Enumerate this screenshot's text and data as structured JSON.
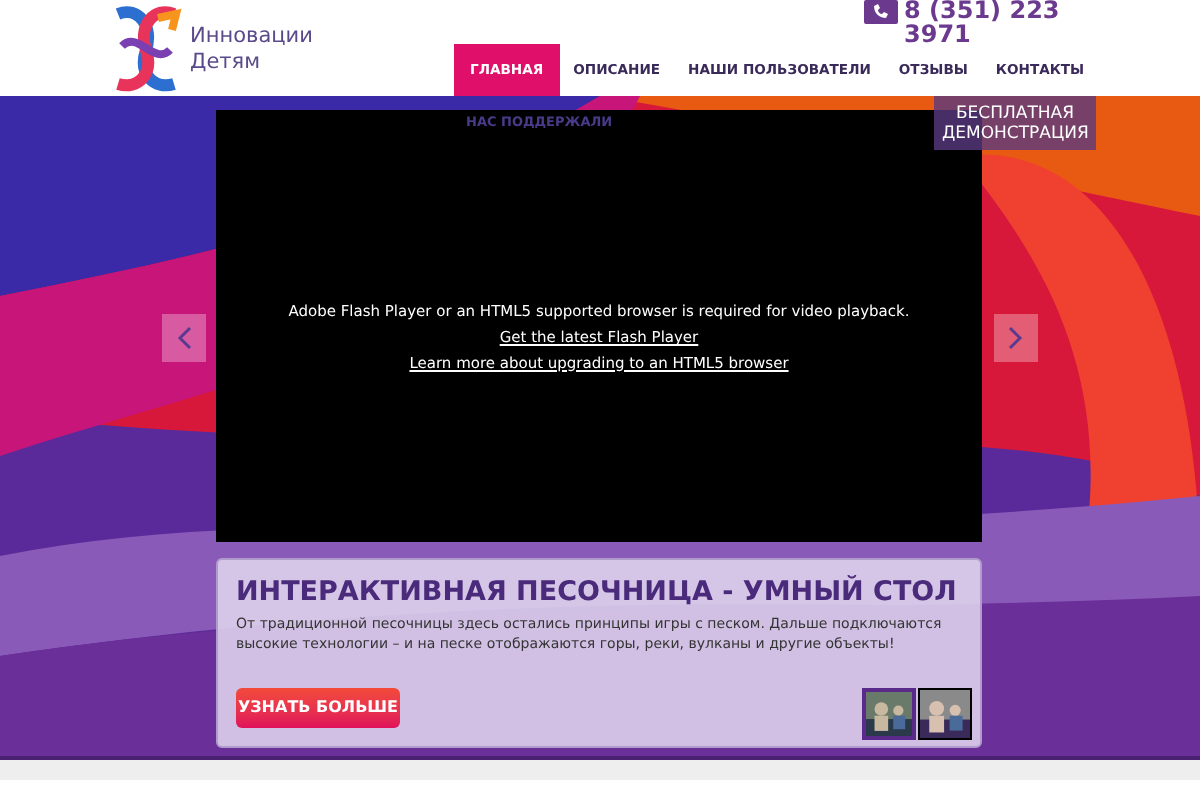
{
  "logo": {
    "line1": "Инновации",
    "line2": "Детям"
  },
  "phone": "8 (351) 223 3971",
  "nav": [
    {
      "label": "ГЛАВНАЯ",
      "selected": true
    },
    {
      "label": "ОПИСАНИЕ",
      "selected": false
    },
    {
      "label": "НАШИ ПОЛЬЗОВАТЕЛИ",
      "selected": false
    },
    {
      "label": "ОТЗЫВЫ",
      "selected": false
    },
    {
      "label": "КОНТАКТЫ",
      "selected": false
    }
  ],
  "demo_button": "БЕСПЛАТНАЯ ДЕМОНСТРАЦИЯ",
  "video": {
    "overlay_title": "НАС ПОДДЕРЖАЛИ",
    "message": "Adobe Flash Player or an HTML5 supported browser is required for video playback.",
    "links": [
      "Get the latest Flash Player",
      "Learn more about upgrading to an HTML5 browser"
    ]
  },
  "slide": {
    "title": "ИНТЕРАКТИВНАЯ ПЕСОЧНИЦА - УМНЫЙ СТОЛ",
    "text": "От традиционной песочницы здесь остались принципы игры с песком. Дальше подключаются высокие технологии – и на песке отображаются горы, реки, вулканы и другие объекты!",
    "button": "УЗНАТЬ БОЛЬШЕ",
    "thumbnails": [
      {
        "selected": true
      },
      {
        "selected": false
      }
    ]
  }
}
